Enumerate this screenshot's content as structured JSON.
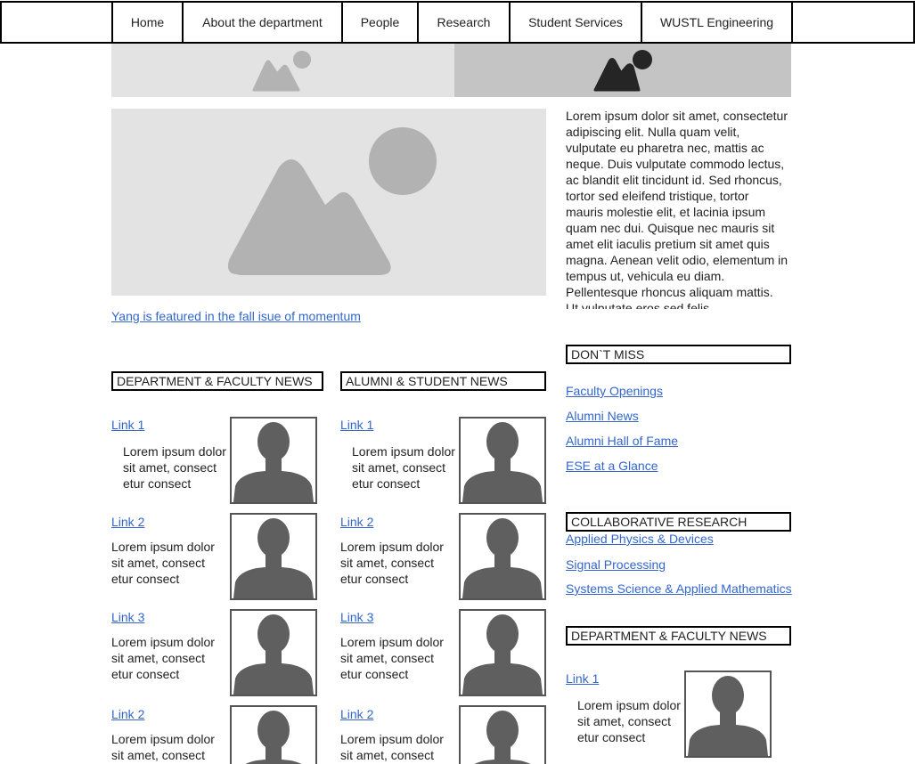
{
  "nav": {
    "items": [
      "Home",
      "About the department",
      "People",
      "Research",
      "Student Services",
      "WUSTL Engineering"
    ]
  },
  "hero": {
    "caption": "Yang is featured in the fall isue of momentum"
  },
  "intro": {
    "text": "Lorem ipsum dolor sit amet, consectetur adipiscing elit. Nulla quam velit, vulputate eu pharetra nec, mattis ac neque. Duis vulputate commodo lectus, ac blandit elit tincidunt id. Sed rhoncus, tortor sed eleifend tristique, tortor mauris molestie elit, et lacinia ipsum quam nec dui. Quisque nec mauris sit amet elit iaculis pretium sit amet quis magna. Aenean velit odio, elementum in tempus ut, vehicula eu diam. Pellentesque rhoncus aliquam mattis. Ut vulputate eros sed felis"
  },
  "dept_news": {
    "heading": "DEPARTMENT & FACULTY NEWS",
    "items": [
      {
        "link": "Link 1",
        "text": "Lorem ipsum dolor sit amet, consect etur consect"
      },
      {
        "link": "Link 2",
        "text": "Lorem ipsum dolor sit amet, consect etur consect"
      },
      {
        "link": "Link 3",
        "text": "Lorem ipsum dolor sit amet, consect etur consect"
      },
      {
        "link": "Link 2",
        "text": "Lorem ipsum dolor sit amet, consect"
      }
    ]
  },
  "alumni_news": {
    "heading": "ALUMNI & STUDENT NEWS",
    "items": [
      {
        "link": "Link 1",
        "text": "Lorem ipsum dolor sit amet, consect etur consect"
      },
      {
        "link": "Link 2",
        "text": "Lorem ipsum dolor sit amet, consect etur consect"
      },
      {
        "link": "Link 3",
        "text": "Lorem ipsum dolor sit amet, consect etur consect"
      },
      {
        "link": "Link 2",
        "text": "Lorem ipsum dolor sit amet, consect"
      }
    ]
  },
  "dont_miss": {
    "heading": "DON`T MISS",
    "links": [
      "Faculty Openings",
      "Alumni News",
      "Alumni Hall of Fame",
      "ESE at a Glance"
    ]
  },
  "collab": {
    "heading": "COLLABORATIVE RESEARCH",
    "links": [
      "Applied Physics & Devices",
      "Signal Processing",
      "Systems Science & Applied Mathematics"
    ]
  },
  "side_news": {
    "heading": "DEPARTMENT & FACULTY NEWS",
    "items": [
      {
        "link": "Link 1",
        "text": "Lorem ipsum dolor sit amet, consect etur consect"
      }
    ]
  },
  "colors": {
    "link": "#3366cc",
    "placeholder_light": "#e3e3e3",
    "placeholder_dark": "#c4c4c4",
    "silhouette": "#5f5f5f"
  }
}
